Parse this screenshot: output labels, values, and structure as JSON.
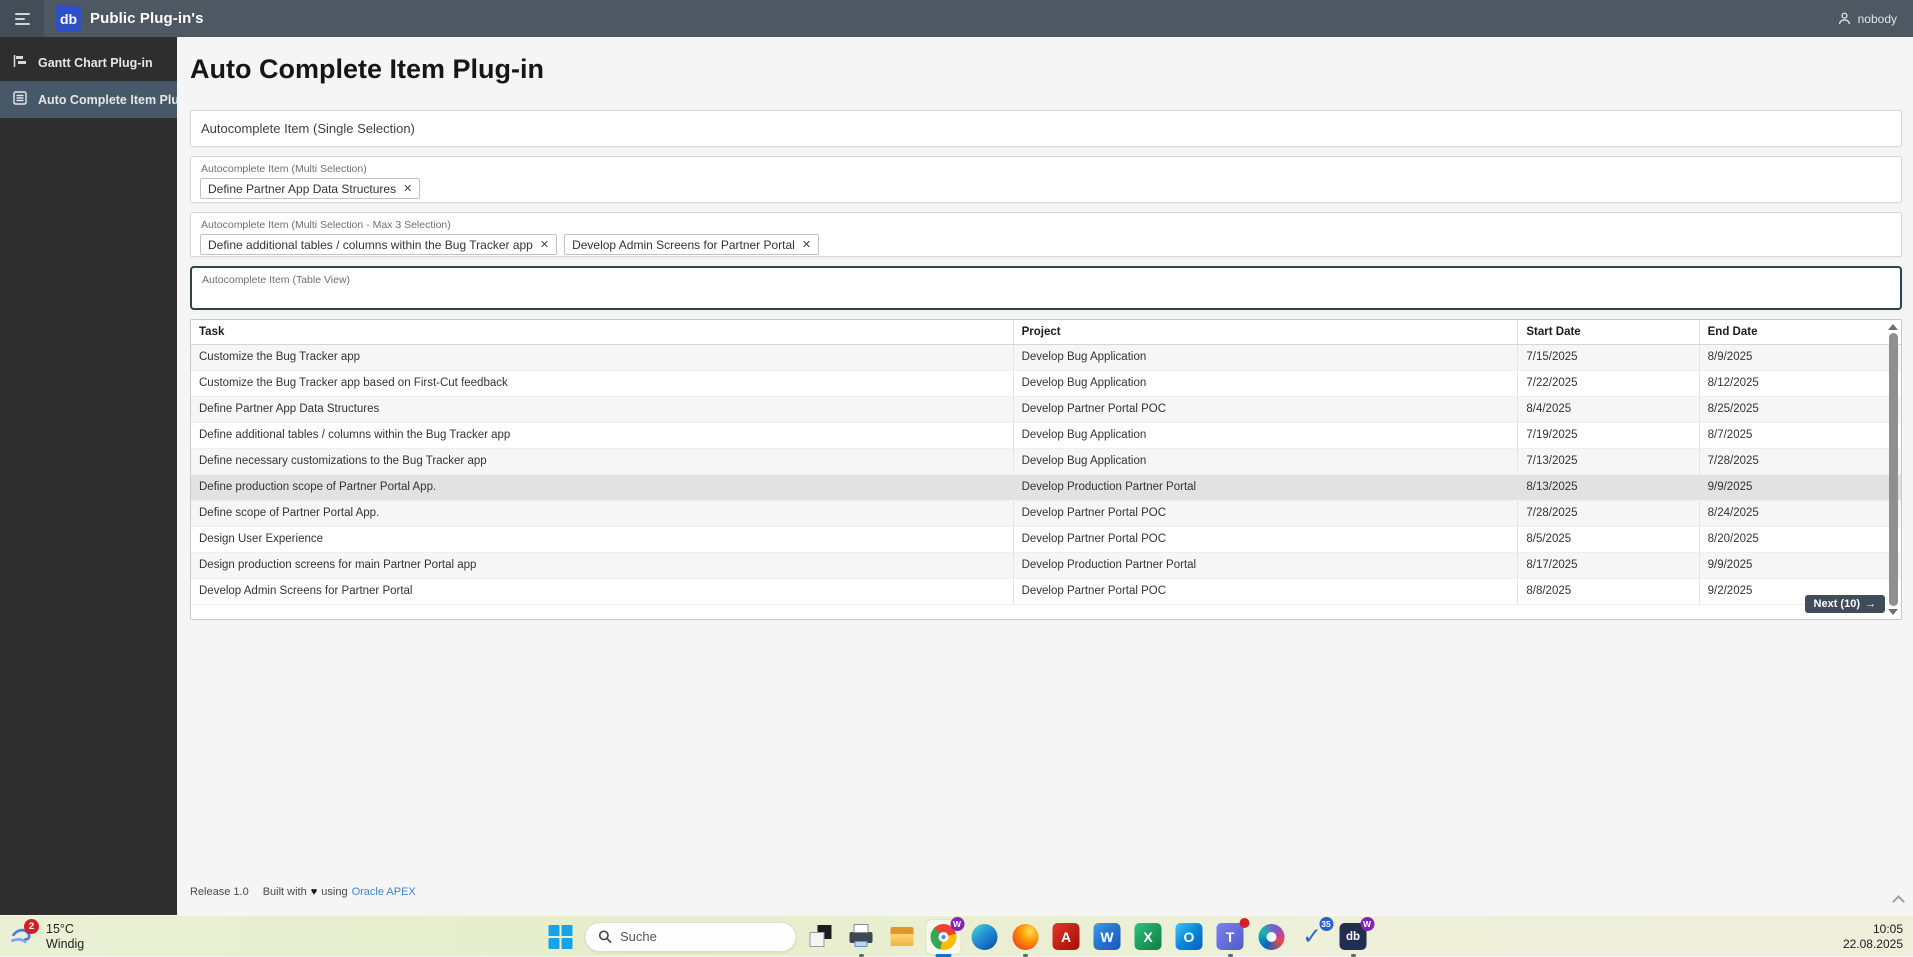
{
  "colors": {
    "header_bg": "#4d5862",
    "hamburger_bg": "#424d57",
    "sidebar_bg": "#2e2e2e",
    "sidebar_active_bg": "#475968",
    "logo_blue": "#2b50c8",
    "focus_border": "#32414e",
    "link": "#3e86c9",
    "button_bg": "#3f4c59",
    "row_highlight": "#e2e2e2",
    "windows_blue": "#18a2e8",
    "badge_purple": "#8324b3",
    "badge_blue": "#2564cf",
    "badge_red": "#d21f2c"
  },
  "glyphs": {
    "close": "✕",
    "arrow_right": "→",
    "heart": "♥",
    "check": "✓"
  },
  "header": {
    "logo_text": "db",
    "app_title": "Public Plug-in's",
    "user": "nobody"
  },
  "sidebar": {
    "items": [
      {
        "label": "Gantt Chart Plug-in",
        "icon": "gantt-icon",
        "slug": "gantt-chart-plugin",
        "active": false
      },
      {
        "label": "Auto Complete Item Plu...",
        "icon": "list-icon",
        "slug": "auto-complete-item-plugin",
        "active": true
      }
    ]
  },
  "main": {
    "page_title": "Auto Complete Item Plug-in",
    "fields": [
      {
        "placeholder": "Autocomplete Item (Single Selection)"
      },
      {
        "label": "Autocomplete Item (Multi Selection)",
        "chips": [
          "Define Partner App Data Structures"
        ]
      },
      {
        "label": "Autocomplete Item (Multi Selection - Max 3 Selection)",
        "chips": [
          "Define additional tables / columns within the Bug Tracker app",
          "Develop Admin Screens for Partner Portal"
        ]
      },
      {
        "label": "Autocomplete Item (Table View)",
        "value": "",
        "focused": true
      }
    ],
    "results_table": {
      "columns": [
        "Task",
        "Project",
        "Start Date",
        "End Date"
      ],
      "rows": [
        [
          "Customize the Bug Tracker app",
          "Develop Bug Application",
          "7/15/2025",
          "8/9/2025"
        ],
        [
          "Customize the Bug Tracker app based on First-Cut feedback",
          "Develop Bug Application",
          "7/22/2025",
          "8/12/2025"
        ],
        [
          "Define Partner App Data Structures",
          "Develop Partner Portal POC",
          "8/4/2025",
          "8/25/2025"
        ],
        [
          "Define additional tables / columns within the Bug Tracker app",
          "Develop Bug Application",
          "7/19/2025",
          "8/7/2025"
        ],
        [
          "Define necessary customizations to the Bug Tracker app",
          "Develop Bug Application",
          "7/13/2025",
          "7/28/2025"
        ],
        [
          "Define production scope of Partner Portal App.",
          "Develop Production Partner Portal",
          "8/13/2025",
          "9/9/2025"
        ],
        [
          "Define scope of Partner Portal App.",
          "Develop Partner Portal POC",
          "7/28/2025",
          "8/24/2025"
        ],
        [
          "Design User Experience",
          "Develop Partner Portal POC",
          "8/5/2025",
          "8/20/2025"
        ],
        [
          "Design production screens for main Partner Portal app",
          "Develop Production Partner Portal",
          "8/17/2025",
          "9/9/2025"
        ],
        [
          "Develop Admin Screens for Partner Portal",
          "Develop Partner Portal POC",
          "8/8/2025",
          "9/2/2025"
        ]
      ],
      "highlighted_row_index": 5,
      "next_label": "Next (10)"
    }
  },
  "footer": {
    "release": "Release 1.0",
    "built_with": "Built with",
    "using": "using",
    "link": "Oracle APEX"
  },
  "taskbar": {
    "weather": {
      "temp": "15°C",
      "condition": "Windig",
      "badge": "2"
    },
    "search_placeholder": "Suche",
    "icons": [
      {
        "name": "task-switcher"
      },
      {
        "name": "printer",
        "running": true
      },
      {
        "name": "file-explorer"
      },
      {
        "name": "chrome",
        "active": true,
        "badge": "W",
        "badge_color": "#8324b3"
      },
      {
        "name": "edge"
      },
      {
        "name": "firefox",
        "running": true
      },
      {
        "name": "acrobat",
        "text": "A"
      },
      {
        "name": "word",
        "text": "W"
      },
      {
        "name": "excel",
        "text": "X"
      },
      {
        "name": "outlook",
        "text": "O"
      },
      {
        "name": "teams",
        "text": "T",
        "running": true,
        "notification_dot": true
      },
      {
        "name": "copilot"
      },
      {
        "name": "todo",
        "badge": "35",
        "badge_color": "#2564cf"
      },
      {
        "name": "db-plugin-app",
        "text": "db",
        "badge": "W",
        "badge_color": "#8324b3",
        "running": true
      }
    ],
    "clock": {
      "time": "10:05",
      "date": "22.08.2025"
    }
  }
}
